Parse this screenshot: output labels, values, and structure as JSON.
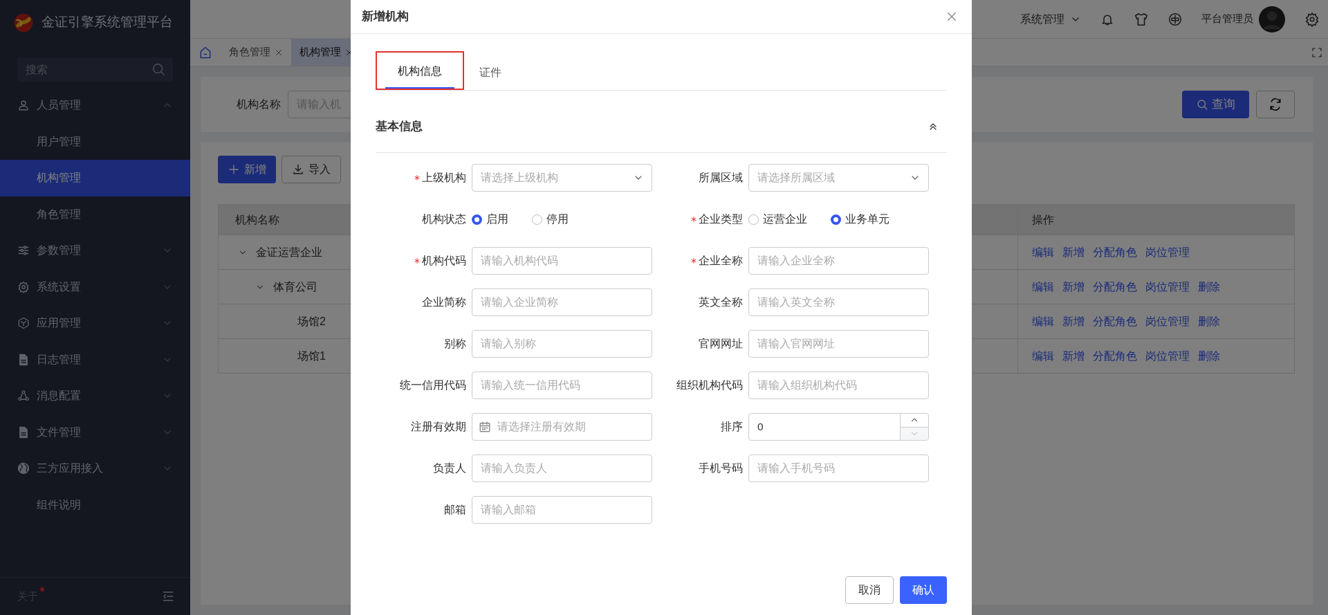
{
  "sidebar": {
    "brand": "金证引擎系统管理平台",
    "search": {
      "placeholder": "搜索"
    },
    "items": [
      {
        "label": "人员管理",
        "expanded": true,
        "selected": false,
        "children": [
          {
            "label": "用户管理",
            "selected": false
          },
          {
            "label": "机构管理",
            "selected": true
          },
          {
            "label": "角色管理",
            "selected": false
          }
        ]
      },
      {
        "label": "参数管理",
        "expanded": false,
        "selected": false
      },
      {
        "label": "系统设置",
        "expanded": false,
        "selected": false
      },
      {
        "label": "应用管理",
        "expanded": false,
        "selected": false
      },
      {
        "label": "日志管理",
        "expanded": false,
        "selected": false
      },
      {
        "label": "消息配置",
        "expanded": false,
        "selected": false
      },
      {
        "label": "文件管理",
        "expanded": false,
        "selected": false
      },
      {
        "label": "三方应用接入",
        "expanded": false,
        "selected": false
      },
      {
        "label": "组件说明",
        "selected": false
      }
    ],
    "about": {
      "label": "关于",
      "dot": true
    }
  },
  "header": {
    "menu": "系统管理",
    "user": "平台管理员"
  },
  "tabs": [
    {
      "label": "角色管理",
      "selected": false
    },
    {
      "label": "机构管理",
      "selected": true
    }
  ],
  "filter": {
    "label": "机构名称",
    "placeholder": "请输入机",
    "search_button": "查询"
  },
  "toolbar": {
    "buttons": [
      {
        "kind": "primary",
        "label": "新增"
      },
      {
        "kind": "import",
        "label": "导入"
      }
    ]
  },
  "table": {
    "columns": [
      "机构名称",
      "操作"
    ],
    "rows": [
      {
        "name": "金证运营企业",
        "expanded": true,
        "actions": [
          "编辑",
          "新增",
          "分配角色",
          "岗位管理"
        ],
        "children": [
          {
            "name": "体育公司",
            "expanded": true,
            "actions": [
              "编辑",
              "新增",
              "分配角色",
              "岗位管理",
              "删除"
            ],
            "children": [
              {
                "name": "场馆2",
                "actions": [
                  "编辑",
                  "新增",
                  "分配角色",
                  "岗位管理",
                  "删除"
                ]
              },
              {
                "name": "场馆1",
                "actions": [
                  "编辑",
                  "新增",
                  "分配角色",
                  "岗位管理",
                  "删除"
                ]
              }
            ]
          }
        ]
      }
    ]
  },
  "dialog": {
    "title": "新增机构",
    "tabs": [
      {
        "label": "机构信息",
        "selected": true,
        "highlighted": true
      },
      {
        "label": "证件",
        "selected": false,
        "highlighted": false
      }
    ],
    "section": {
      "title": "基本信息",
      "expanded": true
    },
    "fields": [
      {
        "kind": "select",
        "label": "上级机构",
        "required": true,
        "placeholder": "请选择上级机构"
      },
      {
        "kind": "select",
        "label": "所属区域",
        "required": false,
        "placeholder": "请选择所属区域"
      },
      {
        "kind": "radio",
        "label": "机构状态",
        "required": false,
        "options": [
          {
            "label": "启用",
            "selected": true
          },
          {
            "label": "停用",
            "selected": false
          }
        ]
      },
      {
        "kind": "radio",
        "label": "企业类型",
        "required": true,
        "options": [
          {
            "label": "运营企业",
            "selected": false
          },
          {
            "label": "业务单元",
            "selected": true
          }
        ]
      },
      {
        "kind": "text",
        "label": "机构代码",
        "required": true,
        "placeholder": "请输入机构代码"
      },
      {
        "kind": "text",
        "label": "企业全称",
        "required": true,
        "placeholder": "请输入企业全称"
      },
      {
        "kind": "text",
        "label": "企业简称",
        "required": false,
        "placeholder": "请输入企业简称"
      },
      {
        "kind": "text",
        "label": "英文全称",
        "required": false,
        "placeholder": "请输入英文全称"
      },
      {
        "kind": "text",
        "label": "别称",
        "required": false,
        "placeholder": "请输入别称"
      },
      {
        "kind": "text",
        "label": "官网网址",
        "required": false,
        "placeholder": "请输入官网网址"
      },
      {
        "kind": "text",
        "label": "统一信用代码",
        "required": false,
        "placeholder": "请输入统一信用代码"
      },
      {
        "kind": "text",
        "label": "组织机构代码",
        "required": false,
        "placeholder": "请输入组织机构代码"
      },
      {
        "kind": "date",
        "label": "注册有效期",
        "required": false,
        "placeholder": "请选择注册有效期"
      },
      {
        "kind": "number",
        "label": "排序",
        "required": false,
        "value": "0"
      },
      {
        "kind": "text",
        "label": "负责人",
        "required": false,
        "placeholder": "请输入负责人"
      },
      {
        "kind": "text",
        "label": "手机号码",
        "required": false,
        "placeholder": "请输入手机号码"
      },
      {
        "kind": "text",
        "label": "邮箱",
        "required": false,
        "placeholder": "请输入邮箱"
      }
    ],
    "buttons": [
      {
        "kind": "cancel",
        "label": "取消"
      },
      {
        "kind": "confirm",
        "label": "确认"
      }
    ]
  }
}
